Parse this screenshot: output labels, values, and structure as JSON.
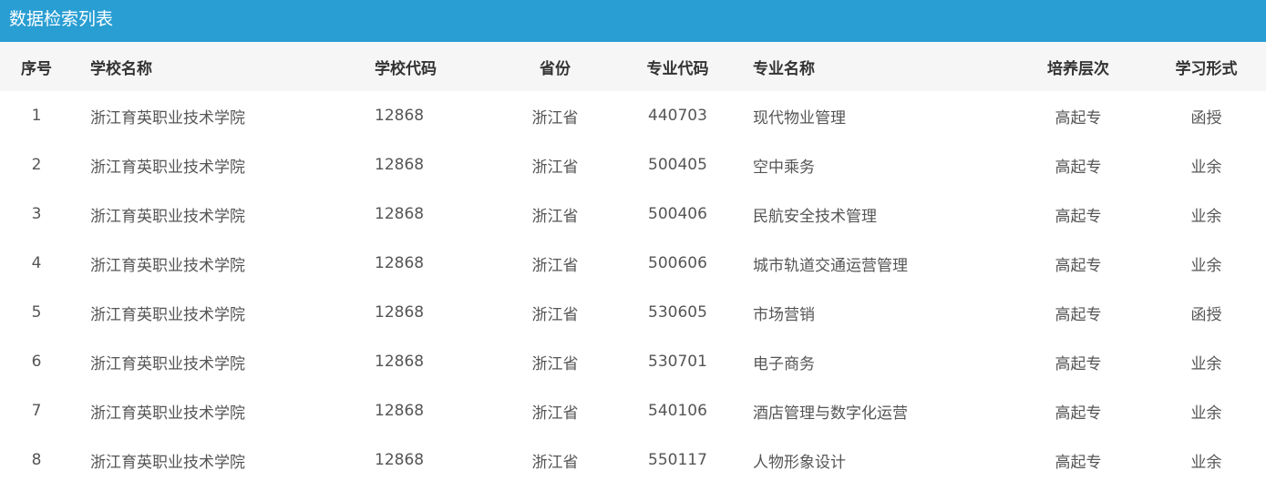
{
  "header": {
    "title": "数据检索列表"
  },
  "columns": [
    "序号",
    "学校名称",
    "学校代码",
    "省份",
    "专业代码",
    "专业名称",
    "培养层次",
    "学习形式"
  ],
  "rows": [
    [
      "1",
      "浙江育英职业技术学院",
      "12868",
      "浙江省",
      "440703",
      "现代物业管理",
      "高起专",
      "函授"
    ],
    [
      "2",
      "浙江育英职业技术学院",
      "12868",
      "浙江省",
      "500405",
      "空中乘务",
      "高起专",
      "业余"
    ],
    [
      "3",
      "浙江育英职业技术学院",
      "12868",
      "浙江省",
      "500406",
      "民航安全技术管理",
      "高起专",
      "业余"
    ],
    [
      "4",
      "浙江育英职业技术学院",
      "12868",
      "浙江省",
      "500606",
      "城市轨道交通运营管理",
      "高起专",
      "业余"
    ],
    [
      "5",
      "浙江育英职业技术学院",
      "12868",
      "浙江省",
      "530605",
      "市场营销",
      "高起专",
      "函授"
    ],
    [
      "6",
      "浙江育英职业技术学院",
      "12868",
      "浙江省",
      "530701",
      "电子商务",
      "高起专",
      "业余"
    ],
    [
      "7",
      "浙江育英职业技术学院",
      "12868",
      "浙江省",
      "540106",
      "酒店管理与数字化运营",
      "高起专",
      "业余"
    ],
    [
      "8",
      "浙江育英职业技术学院",
      "12868",
      "浙江省",
      "550117",
      "人物形象设计",
      "高起专",
      "业余"
    ]
  ],
  "colors": {
    "title_bar": "#299ed3",
    "header_row": "#f6f6f6"
  }
}
